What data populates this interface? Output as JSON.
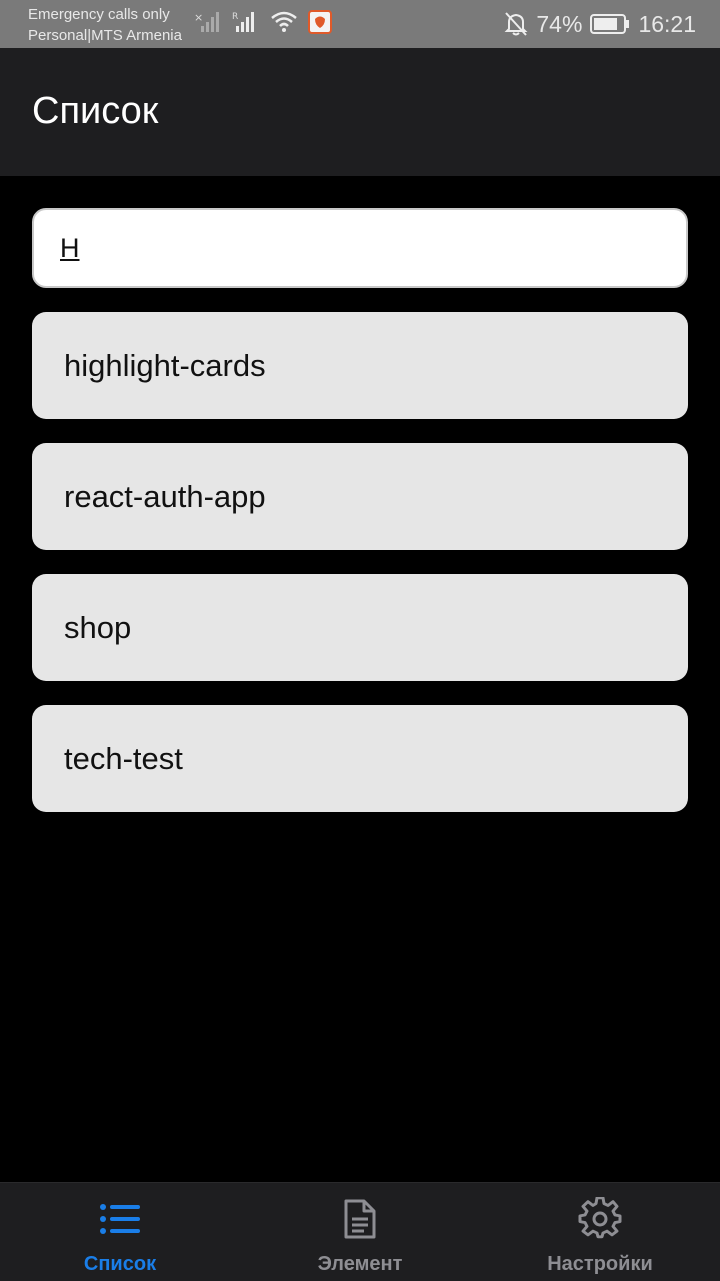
{
  "status_bar": {
    "carrier_line1": "Emergency calls only",
    "carrier_line2": "Personal|MTS Armenia",
    "battery": "74%",
    "time": "16:21",
    "icons": [
      "signal-muted-icon",
      "signal-roaming-icon",
      "wifi-icon",
      "app-notification-icon",
      "bell-off-icon",
      "battery-icon"
    ]
  },
  "header": {
    "title": "Список"
  },
  "search": {
    "value": "H",
    "placeholder": ""
  },
  "list": {
    "items": [
      {
        "label": "highlight-cards"
      },
      {
        "label": "react-auth-app"
      },
      {
        "label": "shop"
      },
      {
        "label": "tech-test"
      }
    ]
  },
  "bottom_nav": {
    "tabs": [
      {
        "label": "Список",
        "icon": "list-icon",
        "active": true
      },
      {
        "label": "Элемент",
        "icon": "document-icon",
        "active": false
      },
      {
        "label": "Настройки",
        "icon": "gear-icon",
        "active": false
      }
    ]
  },
  "colors": {
    "accent": "#1a7ee8",
    "inactive": "#8e8e93",
    "bar": "#1e1e20",
    "card": "#e6e6e6"
  }
}
